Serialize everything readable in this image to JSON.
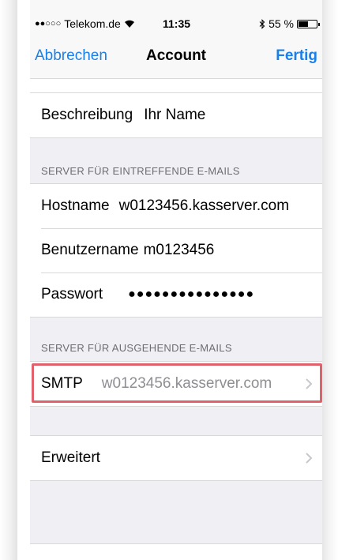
{
  "status_bar": {
    "signal_dots": "●●○○○",
    "carrier": "Telekom.de",
    "time": "11:35",
    "battery_percent": "55 %",
    "battery_level": 0.55
  },
  "nav": {
    "cancel_label": "Abbrechen",
    "title": "Account",
    "done_label": "Fertig"
  },
  "description_row": {
    "label": "Beschreibung",
    "value": "Ihr Name"
  },
  "incoming": {
    "header": "SERVER FÜR EINTREFFENDE E-MAILS",
    "hostname_label": "Hostname",
    "hostname_value": "w0123456.kasserver.com",
    "username_label": "Benutzername",
    "username_value": "m0123456",
    "password_label": "Passwort",
    "password_value": "●●●●●●●●●●●●●●●"
  },
  "outgoing": {
    "header": "SERVER FÜR AUSGEHENDE E-MAILS",
    "smtp_label": "SMTP",
    "smtp_value": "w0123456.kasserver.com"
  },
  "advanced": {
    "label": "Erweitert"
  },
  "colors": {
    "accent": "#1a7fe8",
    "highlight_border": "#e0606b",
    "group_background": "#efeff4"
  },
  "icons": [
    "wifi-icon",
    "bluetooth-icon",
    "battery-icon",
    "chevron-right-icon"
  ]
}
